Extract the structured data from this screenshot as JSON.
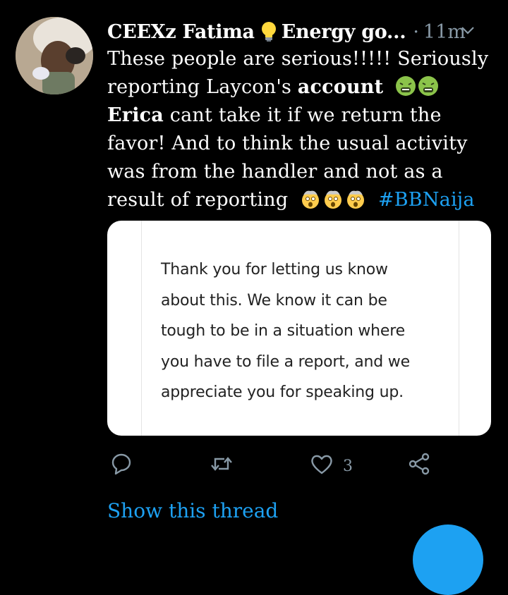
{
  "tweet": {
    "author_name": "CEEXz Fatima",
    "author_name_suffix": "Energy go...",
    "separator": "·",
    "timestamp": "11m",
    "text_line1": "These people are serious!!!!! Seriously",
    "text_line2_a": "reporting Laycon's ",
    "text_line2_bold": "account",
    "text_line3_bold": "Erica",
    "text_line3_b": " cant take it if we return the",
    "text_line4": "favor! And to think the usual activity",
    "text_line5": "was from the handler and not as a",
    "text_line6": "result of reporting",
    "hashtag": "#BBNaija"
  },
  "card": {
    "line1": "Thank you for letting us know",
    "line2": "about this. We know it can be",
    "line3": "tough to be in a situation where",
    "line4": "you have to file a report, and we",
    "line5": "appreciate you for speaking up."
  },
  "actions": {
    "like_count": "3"
  },
  "show_thread_label": "Show this thread",
  "icons": {
    "emoji_sick": "nauseated-face-icon",
    "emoji_mind_blown": "exploding-head-icon",
    "bulb": "light-bulb-icon"
  },
  "colors": {
    "background": "#000000",
    "accent": "#1da1f2",
    "muted": "#8899a6"
  }
}
